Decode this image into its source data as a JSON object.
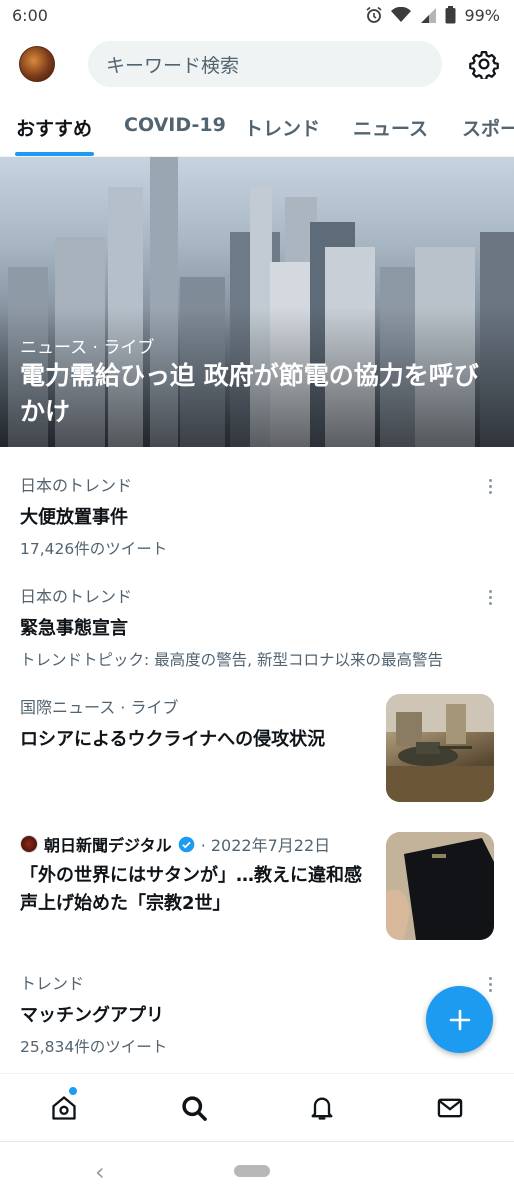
{
  "status_bar": {
    "time": "6:00",
    "battery": "99%",
    "icons": [
      "alarm-icon",
      "wifi-icon",
      "signal-icon",
      "battery-icon"
    ]
  },
  "header": {
    "search_placeholder": "キーワード検索",
    "settings_icon": "gear-icon"
  },
  "tabs": [
    {
      "label": "おすすめ",
      "active": true
    },
    {
      "label": "COVID-19",
      "active": false
    },
    {
      "label": "トレンド",
      "active": false
    },
    {
      "label": "ニュース",
      "active": false
    },
    {
      "label": "スポー",
      "active": false
    }
  ],
  "hero": {
    "category": "ニュース · ライブ",
    "title": "電力需給ひっ迫 政府が節電の協力を呼びかけ"
  },
  "feed": [
    {
      "category": "日本のトレンド",
      "title": "大便放置事件",
      "meta": "17,426件のツイート"
    },
    {
      "category": "日本のトレンド",
      "title": "緊急事態宣言",
      "meta": "トレンドトピック: 最高度の警告, 新型コロナ以来の最高警告"
    },
    {
      "category": "国際ニュース · ライブ",
      "title": "ロシアによるウクライナへの侵攻状況"
    },
    {
      "source": "朝日新聞デジタル",
      "date": "· 2022年7月22日",
      "title": "「外の世界にはサタンが」…教えに違和感　声上げ始めた「宗教2世」"
    },
    {
      "category": "トレンド",
      "title": "マッチングアプリ",
      "meta": "25,834件のツイート"
    }
  ],
  "fab": {
    "icon": "plus-icon"
  },
  "bottom_nav": [
    "home-icon",
    "search-icon",
    "bell-icon",
    "mail-icon"
  ],
  "colors": {
    "accent": "#1d9bf0",
    "text": "#0f1419",
    "secondary": "#536471"
  }
}
